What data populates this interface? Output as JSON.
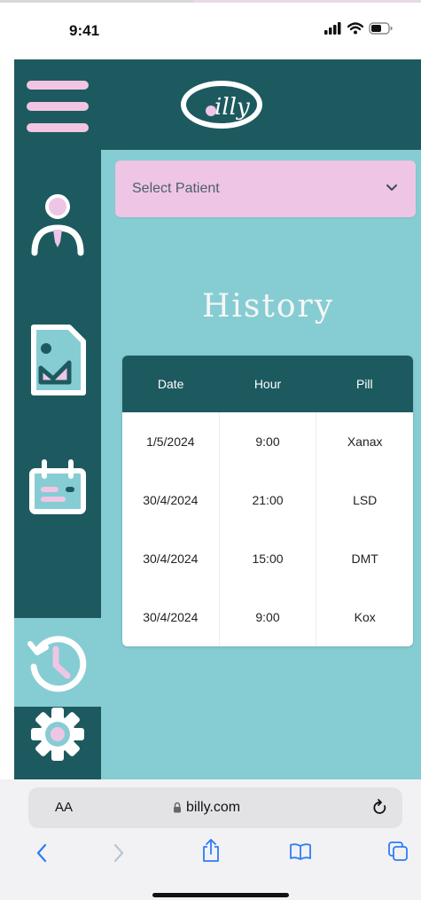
{
  "status_bar": {
    "time": "9:41"
  },
  "header": {
    "logo_text": "billy"
  },
  "patient_select": {
    "placeholder": "Select Patient"
  },
  "page": {
    "title": "History"
  },
  "history_table": {
    "headers": [
      "Date",
      "Hour",
      "Pill"
    ],
    "rows": [
      [
        "1/5/2024",
        "9:00",
        "Xanax"
      ],
      [
        "30/4/2024",
        "21:00",
        "LSD"
      ],
      [
        "30/4/2024",
        "15:00",
        "DMT"
      ],
      [
        "30/4/2024",
        "9:00",
        "Kox"
      ]
    ]
  },
  "sidebar": {
    "items": [
      {
        "icon": "person-icon",
        "active": false
      },
      {
        "icon": "report-icon",
        "active": false
      },
      {
        "icon": "calendar-icon",
        "active": false
      },
      {
        "icon": "history-icon",
        "active": true
      },
      {
        "icon": "gear-icon",
        "active": false
      }
    ]
  },
  "browser": {
    "text_size_label": "AA",
    "url": "billy.com"
  },
  "colors": {
    "dark_teal": "#1d5a60",
    "light_teal": "#86cdd3",
    "pink": "#efc5e6",
    "white": "#ffffff"
  }
}
